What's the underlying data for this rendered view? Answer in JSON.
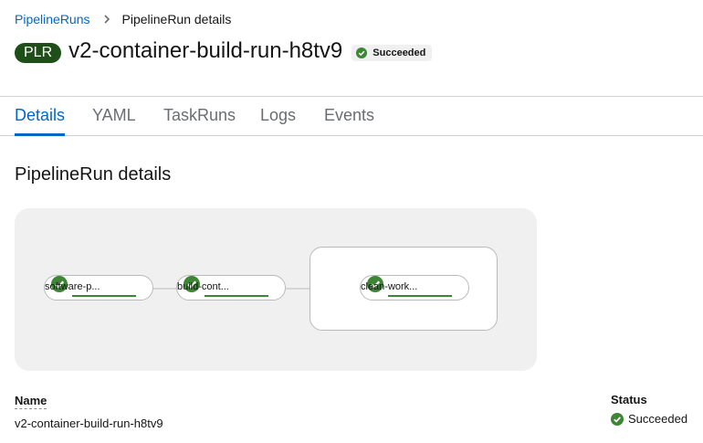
{
  "breadcrumb": {
    "parent": "PipelineRuns",
    "current": "PipelineRun details"
  },
  "header": {
    "resource_badge": "PLR",
    "title": "v2-container-build-run-h8tv9",
    "status": "Succeeded"
  },
  "tabs": [
    {
      "label": "Details",
      "active": true
    },
    {
      "label": "YAML",
      "active": false
    },
    {
      "label": "TaskRuns",
      "active": false
    },
    {
      "label": "Logs",
      "active": false
    },
    {
      "label": "Events",
      "active": false
    }
  ],
  "section": {
    "title": "PipelineRun details"
  },
  "graph": {
    "tasks": [
      {
        "label": "software-p...",
        "status": "succeeded",
        "progress": 1.0
      },
      {
        "label": "build-cont...",
        "status": "succeeded",
        "progress": 1.0
      }
    ],
    "finally_tasks": [
      {
        "label": "clean-work...",
        "status": "succeeded",
        "progress": 1.0
      }
    ]
  },
  "details": {
    "name_label": "Name",
    "name_value": "v2-container-build-run-h8tv9",
    "status_label": "Status",
    "status_value": "Succeeded"
  },
  "colors": {
    "success": "#3e8635",
    "link": "#0066cc",
    "badge_bg": "#1e4f18"
  }
}
